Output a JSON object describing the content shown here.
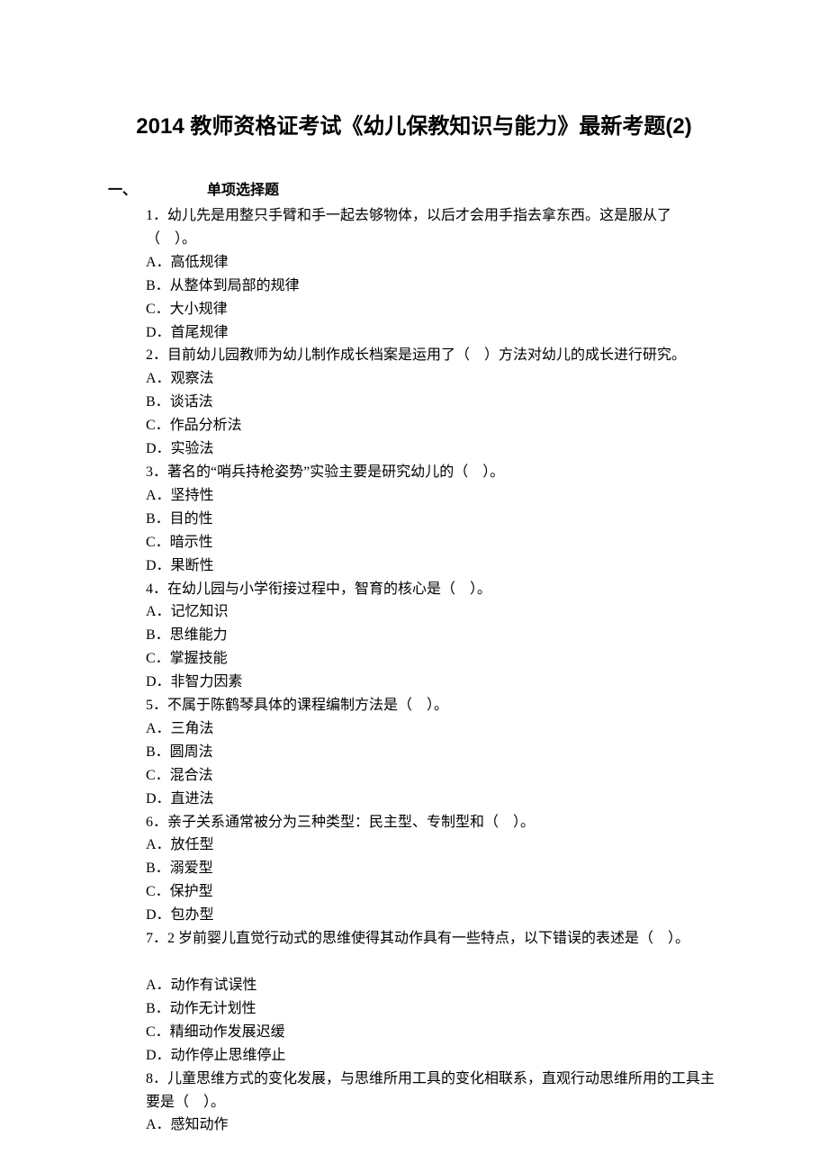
{
  "title": "2014 教师资格证考试《幼儿保教知识与能力》最新考题(2)",
  "section": {
    "num": "一、",
    "label": "单项选择题"
  },
  "q1": {
    "stem": "1．幼儿先是用整只手臂和手一起去够物体，以后才会用手指去拿东西。这是服从了（　）。",
    "A": "A．高低规律",
    "B": "B．从整体到局部的规律",
    "C": "C．大小规律",
    "D": "D．首尾规律"
  },
  "q2": {
    "stem": "2．目前幼儿园教师为幼儿制作成长档案是运用了（　）方法对幼儿的成长进行研究。",
    "A": "A．观察法",
    "B": "B．谈话法",
    "C": "C．作品分析法",
    "D": "D．实验法"
  },
  "q3": {
    "stem": "3．著名的“哨兵持枪姿势”实验主要是研究幼儿的（　）。",
    "A": "A．坚持性",
    "B": "B．目的性",
    "C": "C．暗示性",
    "D": "D．果断性"
  },
  "q4": {
    "stem": "4．在幼儿园与小学衔接过程中，智育的核心是（　）。",
    "A": "A．记忆知识",
    "B": "B．思维能力",
    "C": "C．掌握技能",
    "D": "D．非智力因素"
  },
  "q5": {
    "stem": "5．不属于陈鹤琴具体的课程编制方法是（　）。",
    "A": "A．三角法",
    "B": "B．圆周法",
    "C": "C．混合法",
    "D": "D．直进法"
  },
  "q6": {
    "stem": "6．亲子关系通常被分为三种类型：民主型、专制型和（　）。",
    "A": "A．放任型",
    "B": "B．溺爱型",
    "C": "C．保护型",
    "D": "D．包办型"
  },
  "q7": {
    "stem": "7．2 岁前婴儿直觉行动式的思维使得其动作具有一些特点，以下错误的表述是（　）。",
    "A": "A．动作有试误性",
    "B": "B．动作无计划性",
    "C": "C．精细动作发展迟缓",
    "D": "D．动作停止思维停止"
  },
  "q8": {
    "stem": "8．儿童思维方式的变化发展，与思维所用工具的变化相联系，直观行动思维所用的工具主要是（　）。",
    "A": "A．感知动作"
  }
}
